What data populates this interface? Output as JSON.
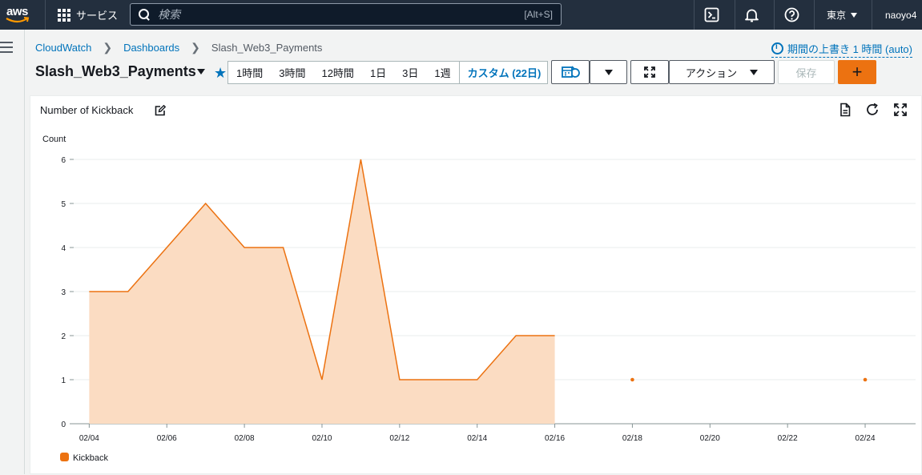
{
  "topnav": {
    "logo_text": "aws",
    "services_label": "サービス",
    "search_placeholder": "検索",
    "search_shortcut": "[Alt+S]",
    "region_label": "東京",
    "user_label": "naoyo4"
  },
  "breadcrumb": {
    "items": [
      "CloudWatch",
      "Dashboards",
      "Slash_Web3_Payments"
    ]
  },
  "override_label": "期間の上書き 1 時間 (auto)",
  "page_title": "Slash_Web3_Payments",
  "time_range": {
    "options": [
      "1時間",
      "3時間",
      "12時間",
      "1日",
      "3日",
      "1週"
    ],
    "custom_label": "カスタム (22日)"
  },
  "toolbar": {
    "actions_label": "アクション",
    "save_label": "保存",
    "add_label": "+"
  },
  "widget": {
    "title": "Number of Kickback"
  },
  "colors": {
    "series": "#ec7211",
    "fill": "#fbdcc2",
    "link": "#0073bb"
  },
  "chart_data": {
    "type": "area",
    "title": "Number of Kickback",
    "ylabel": "Count",
    "xlabel": "",
    "ylim": [
      0,
      6
    ],
    "y_ticks": [
      0,
      1,
      2,
      3,
      4,
      5,
      6
    ],
    "x_tick_labels": [
      "02/04",
      "02/06",
      "02/08",
      "02/10",
      "02/12",
      "02/14",
      "02/16",
      "02/18",
      "02/20",
      "02/22",
      "02/24"
    ],
    "x_tick_days": [
      4,
      6,
      8,
      10,
      12,
      14,
      16,
      18,
      20,
      22,
      24
    ],
    "x_range_days": [
      3.6,
      25.3
    ],
    "legend_placement": "bottom-left",
    "grid": true,
    "series": [
      {
        "name": "Kickback",
        "points": [
          {
            "x": "02/04",
            "y": 3
          },
          {
            "x": "02/05",
            "y": 3
          },
          {
            "x": "02/06",
            "y": 4
          },
          {
            "x": "02/07",
            "y": 5
          },
          {
            "x": "02/08",
            "y": 4
          },
          {
            "x": "02/09",
            "y": 4
          },
          {
            "x": "02/10",
            "y": 1
          },
          {
            "x": "02/11",
            "y": 6
          },
          {
            "x": "02/12",
            "y": 1
          },
          {
            "x": "02/13",
            "y": 1
          },
          {
            "x": "02/14",
            "y": 1
          },
          {
            "x": "02/15",
            "y": 2
          },
          {
            "x": "02/16",
            "y": 2
          },
          {
            "x": "02/18",
            "y": 1
          },
          {
            "x": "02/24",
            "y": 1
          }
        ]
      }
    ]
  }
}
